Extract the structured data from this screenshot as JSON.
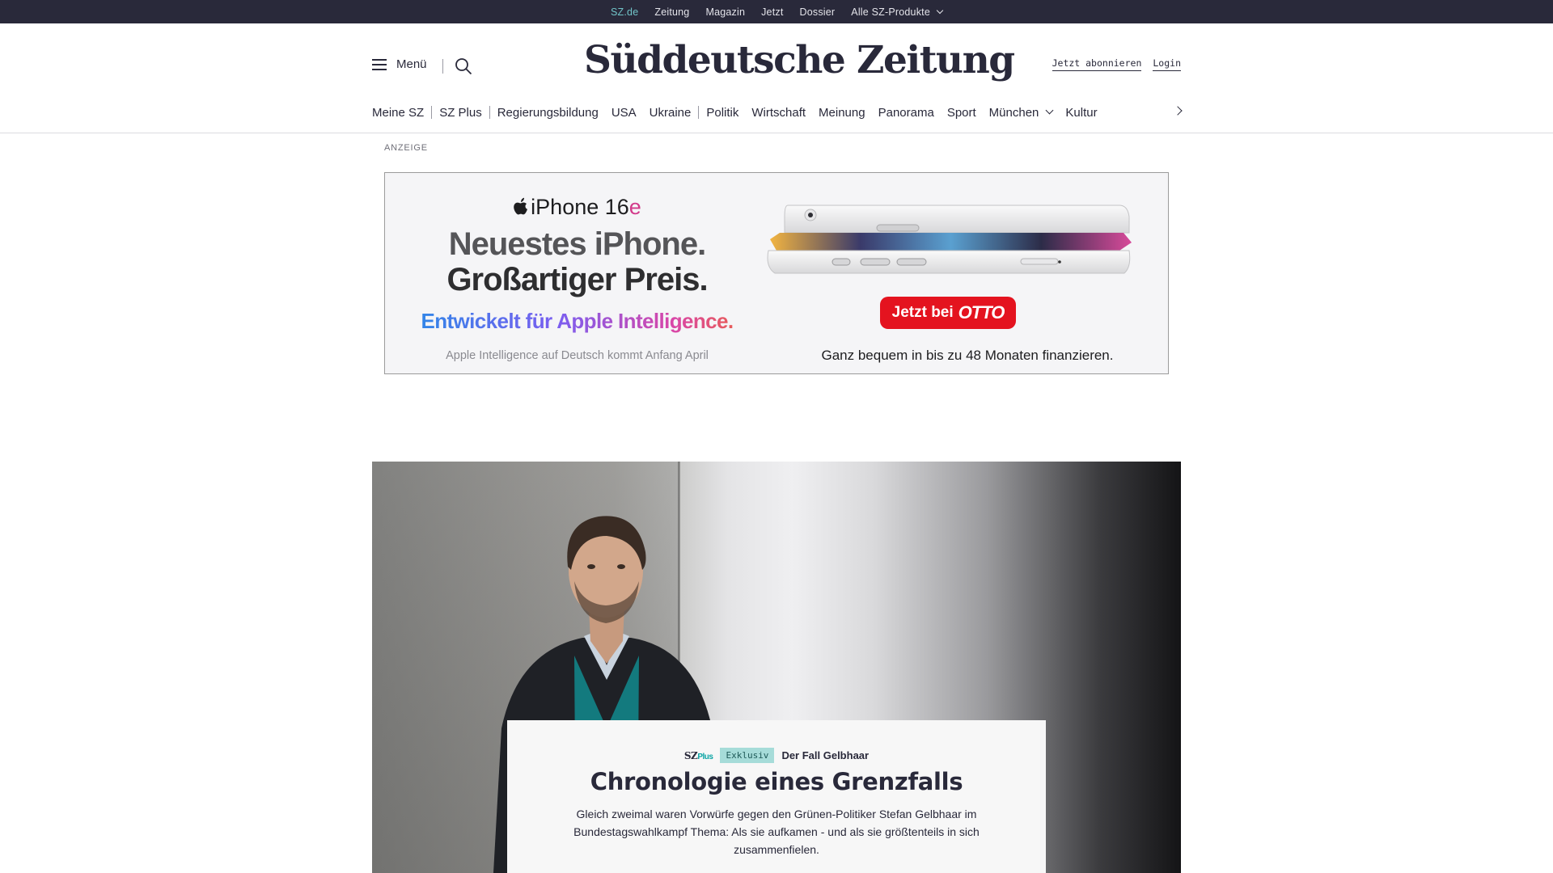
{
  "topbar": {
    "links": [
      "SZ.de",
      "Zeitung",
      "Magazin",
      "Jetzt",
      "Dossier",
      "Alle SZ-Produkte"
    ]
  },
  "header": {
    "menu_label": "Menü",
    "logo_text": "Süddeutsche Zeitung",
    "subscribe_label": "Jetzt abonnieren",
    "login_label": "Login"
  },
  "nav": {
    "items": [
      "Meine SZ",
      "SZ Plus",
      "Regierungsbildung",
      "USA",
      "Ukraine",
      "Politik",
      "Wirtschaft",
      "Meinung",
      "Panorama",
      "Sport",
      "München",
      "Kultur"
    ]
  },
  "ad": {
    "label": "ANZEIGE",
    "product_name": "iPhone 16",
    "product_suffix": "e",
    "headline_line1": "Neuestes iPhone.",
    "headline_line2": "Großartiger Preis.",
    "intelligence_line": "Entwickelt für Apple Intelligence.",
    "note": "Apple Intelligence auf Deutsch kommt Anfang April",
    "cta_text": "Jetzt bei",
    "cta_brand": "OTTO",
    "finance_text": "Ganz bequem in bis zu 48 Monaten finanzieren."
  },
  "hero": {
    "brand_sz": "SZ",
    "brand_plus": "Plus",
    "badge": "Exklusiv",
    "kicker": "Der Fall Gelbhaar",
    "title": "Chronologie eines Grenzfalls",
    "teaser": "Gleich zweimal waren Vorwürfe gegen den Grünen-Politiker Stefan Gelbhaar im Bundestagswahlkampf Thema: Als sie aufkamen - und als sie größtenteils in sich zusammenfielen."
  },
  "colors": {
    "brand_dark": "#29293a",
    "accent_teal": "#71c4c8",
    "otto_red": "#e4131f"
  }
}
